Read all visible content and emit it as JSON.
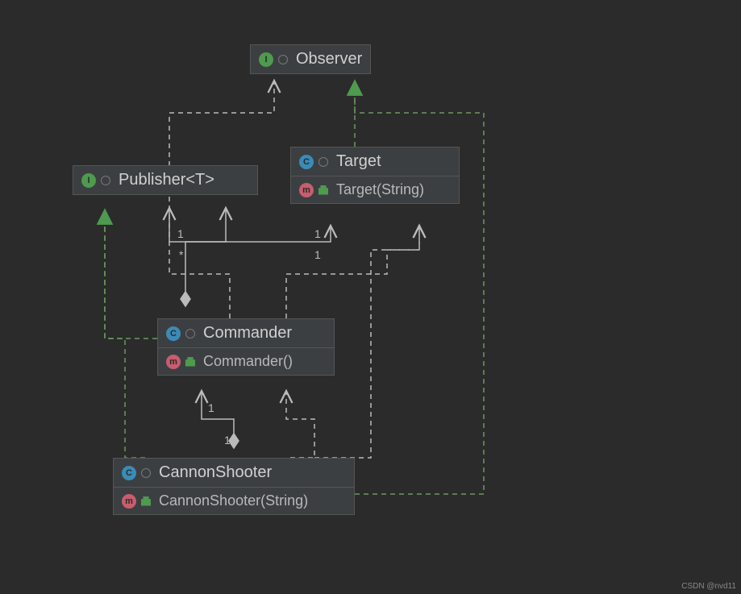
{
  "classes": {
    "observer": {
      "kind": "I",
      "name": "Observer"
    },
    "publisher": {
      "kind": "I",
      "name": "Publisher<T>"
    },
    "target": {
      "kind": "C",
      "name": "Target",
      "ctor": "Target(String)"
    },
    "commander": {
      "kind": "C",
      "name": "Commander",
      "ctor": "Commander()"
    },
    "cannonshooter": {
      "kind": "C",
      "name": "CannonShooter",
      "ctor": "CannonShooter(String)"
    }
  },
  "multiplicities": {
    "pub1": "1",
    "pubStar": "*",
    "tgt1a": "1",
    "tgt1b": "1",
    "cmd1": "1",
    "cs1": "1"
  },
  "watermark": "CSDN @nvd11",
  "chart_data": {
    "type": "diagram",
    "diagram_kind": "uml-class",
    "title": "",
    "nodes": [
      {
        "id": "Observer",
        "stereotype": "interface",
        "members": []
      },
      {
        "id": "Publisher<T>",
        "stereotype": "interface",
        "members": []
      },
      {
        "id": "Target",
        "stereotype": "class",
        "members": [
          "Target(String)"
        ]
      },
      {
        "id": "Commander",
        "stereotype": "class",
        "members": [
          "Commander()"
        ]
      },
      {
        "id": "CannonShooter",
        "stereotype": "class",
        "members": [
          "CannonShooter(String)"
        ]
      }
    ],
    "edges": [
      {
        "from": "Target",
        "to": "Observer",
        "relation": "realization"
      },
      {
        "from": "CannonShooter",
        "to": "Observer",
        "relation": "realization"
      },
      {
        "from": "Commander",
        "to": "Publisher<T>",
        "relation": "realization"
      },
      {
        "from": "CannonShooter",
        "to": "Publisher<T>",
        "relation": "realization"
      },
      {
        "from": "Commander",
        "to": "Observer",
        "relation": "dependency"
      },
      {
        "from": "Commander",
        "to": "Target",
        "relation": "dependency"
      },
      {
        "from": "CannonShooter",
        "to": "Commander",
        "relation": "dependency"
      },
      {
        "from": "CannonShooter",
        "to": "Target",
        "relation": "dependency"
      },
      {
        "from": "Commander",
        "to": "Publisher<T>",
        "relation": "aggregation",
        "from_mult": "*",
        "to_mult": "1"
      },
      {
        "from": "Commander",
        "to": "Target",
        "relation": "association",
        "from_mult": "1",
        "to_mult": "1"
      },
      {
        "from": "CannonShooter",
        "to": "Commander",
        "relation": "aggregation",
        "from_mult": "1",
        "to_mult": "1"
      }
    ]
  }
}
